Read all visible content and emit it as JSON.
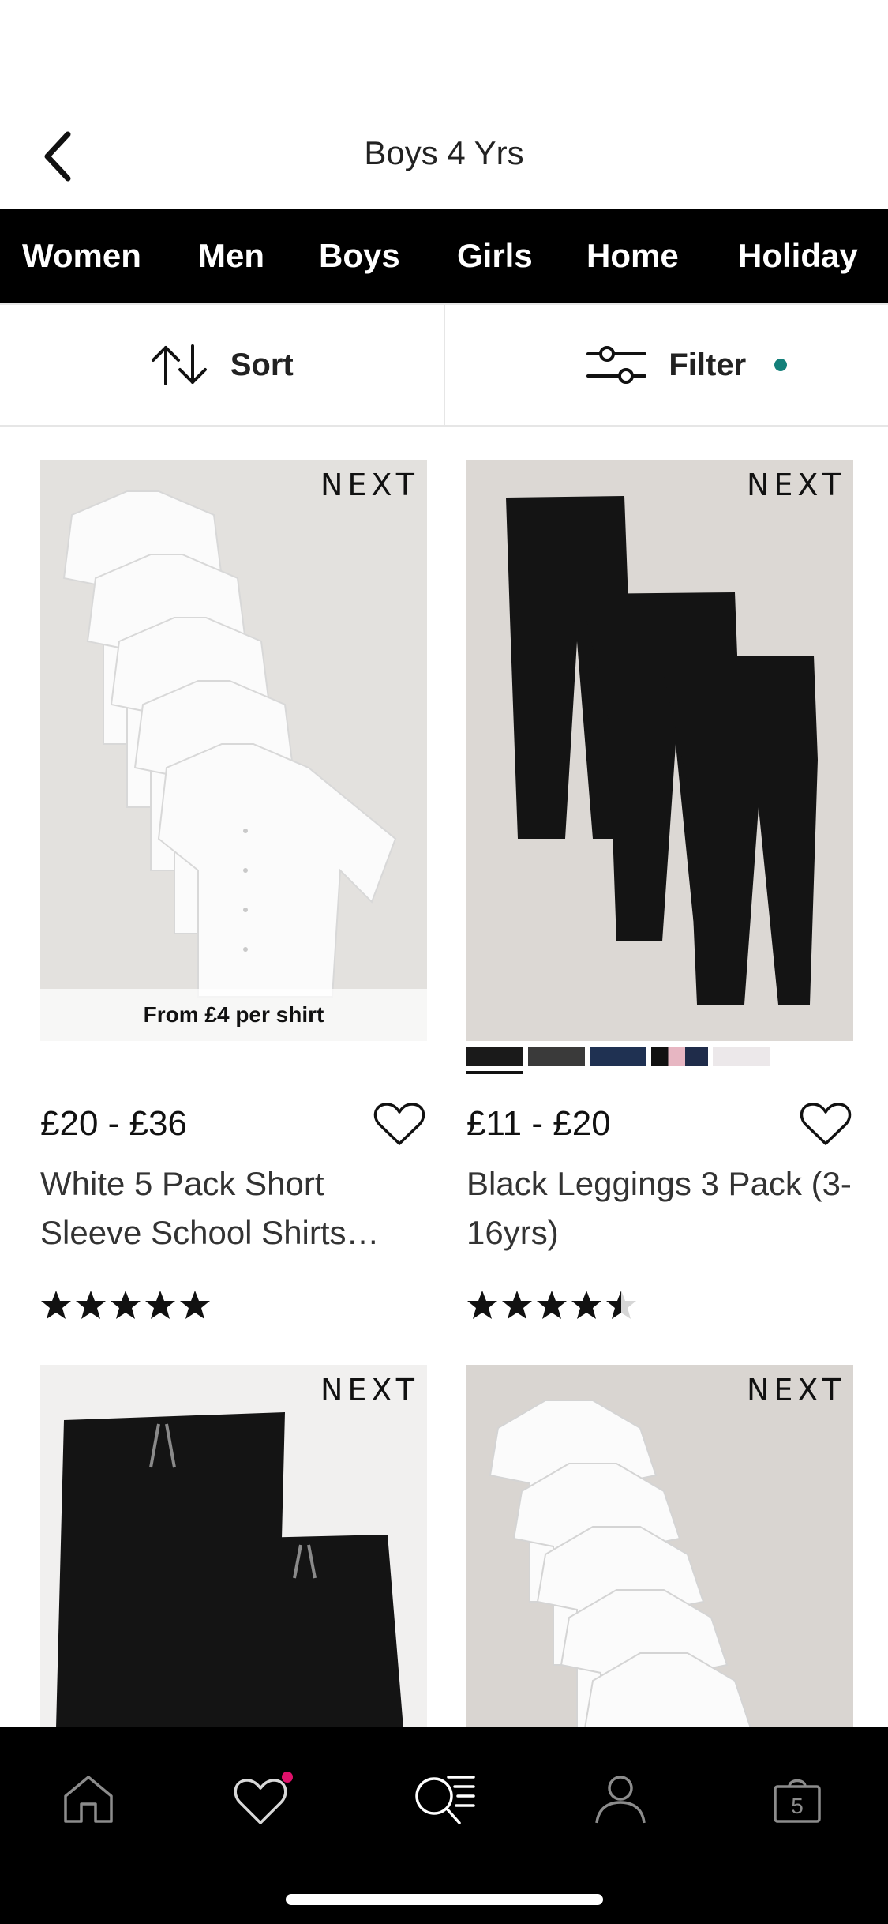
{
  "header": {
    "title": "Boys 4 Yrs",
    "back_icon": "chevron-left-icon"
  },
  "categories": [
    "Women",
    "Men",
    "Boys",
    "Girls",
    "Home",
    "Holiday"
  ],
  "toolbar": {
    "sort_label": "Sort",
    "filter_label": "Filter",
    "filter_active_color": "#14807a"
  },
  "products": [
    {
      "brand": "NEXT",
      "promo": "From £4 per shirt",
      "price": "£20 - £36",
      "name": "White 5 Pack Short Sleeve School Shirts…",
      "rating": 5,
      "swatches": []
    },
    {
      "brand": "NEXT",
      "promo": "",
      "price": "£11 - £20",
      "name": "Black Leggings 3 Pack (3-16yrs)",
      "rating": 4.5,
      "swatches": [
        "#1a1a1a",
        "#3a3a3a",
        "#1f3152",
        "#1b1b2a",
        "#ece8ea"
      ]
    },
    {
      "brand": "NEXT",
      "promo": "",
      "price": "",
      "name": "",
      "rating": null,
      "swatches": []
    },
    {
      "brand": "NEXT",
      "promo": "",
      "price": "",
      "name": "",
      "rating": null,
      "swatches": []
    }
  ],
  "tabbar": {
    "items": [
      "home-icon",
      "wishlist-icon",
      "search-menu-icon",
      "account-icon",
      "bag-icon"
    ],
    "bag_count": "5",
    "wishlist_badge_color": "#e0116b"
  }
}
